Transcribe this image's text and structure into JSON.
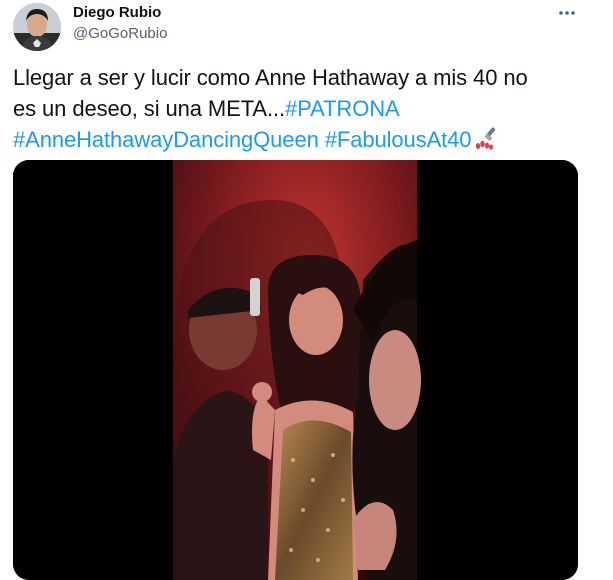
{
  "author": {
    "display_name": "Diego Rubio",
    "handle": "@GoGoRubio"
  },
  "tweet": {
    "text_line1": "Llegar a ser y lucir como Anne Hathaway a mis 40 no",
    "text_line2_prefix": "es un deseo, si una META...",
    "hashtags": [
      "#PATRONA",
      "#AnneHathawayDancingQueen",
      "#FabulousAt40"
    ],
    "emoji": "nail-polish-emoji"
  },
  "icons": {
    "more": "more-options-icon",
    "avatar": "avatar-image"
  },
  "colors": {
    "text": "#0f1419",
    "secondary": "#536471",
    "link": "#1d9bf0",
    "media_bg": "#000000"
  }
}
